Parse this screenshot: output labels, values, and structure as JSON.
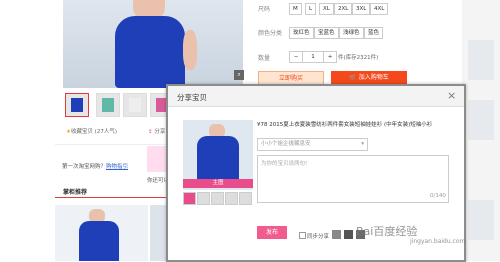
{
  "product": {
    "size_label": "尺码",
    "sizes": [
      "M",
      "L",
      "XL",
      "2XL",
      "3XL",
      "4XL"
    ],
    "color_label": "颜色分类",
    "colors": [
      "玫红色",
      "宝蓝色",
      "浅绿色",
      "蓝色"
    ],
    "qty_label": "数量",
    "qty_value": "1",
    "qty_minus": "−",
    "qty_plus": "+",
    "stock_text": "件(库存2321件)",
    "buy_now": "立即购买",
    "add_cart": "加入购物车",
    "fav_text": "收藏宝贝 (27人气)",
    "share_text": "分享",
    "first_visit": "第一次淘宝网购？",
    "first_visit_link": "购物指引",
    "shop_hint": "你还可以",
    "recommend_tab": "掌柜推荐"
  },
  "modal": {
    "title": "分享宝贝",
    "close": "×",
    "description": "¥78 2015夏上衣夏装雪纺衫两件套女装短袖娃娃衫 (中年女装)短袖小衫",
    "select_placeholder": "小小个姐企拔藏息安",
    "textarea_placeholder": "为你的宝贝说两句!",
    "counter": "0/140",
    "image_tag": "主图",
    "publish": "发布",
    "share_to": "同步分享"
  },
  "watermark": {
    "brand": "Bai百度经验",
    "url": "jingyan.baidu.com"
  },
  "colors": {
    "accent": "#f5491b",
    "pink": "#f25b8e",
    "dress": "#1f3fb8"
  }
}
